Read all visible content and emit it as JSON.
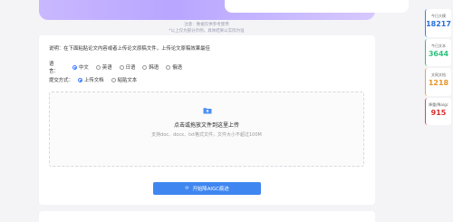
{
  "header": {
    "note_line1": "注意：数据仅供参考使用",
    "note_line2": "*以上仅为部分示例，具体结果以实际为准"
  },
  "form": {
    "instruction": "说明：在下面粘贴论文内容或者上传论文原稿文件，上传论文原稿效果最佳",
    "language_label": "语　　言：",
    "languages": [
      "中文",
      "英语",
      "日语",
      "韩语",
      "俄语"
    ],
    "selected_language": "中文",
    "method_label": "提交方式：",
    "methods": [
      "上传文档",
      "粘贴文本"
    ],
    "selected_method": "上传文档"
  },
  "dropzone": {
    "title": "点击或拖放文件到这里上传",
    "subtitle": "支持doc、docx、txt格式文件，文件大小不超过100M",
    "icon": "folder-upload-icon"
  },
  "start_button": {
    "label": "开始降AIGC痕迹",
    "icon": "refresh-icon"
  },
  "stats": [
    {
      "label": "今日大模",
      "value": "18217",
      "color": "#2a6fd8"
    },
    {
      "label": "今日文本",
      "value": "3644",
      "color": "#2ec27e"
    },
    {
      "label": "文网文档",
      "value": "1218",
      "color": "#e8962a"
    },
    {
      "label": "降重/降aigc",
      "value": "915",
      "color": "#d63030"
    }
  ],
  "colors": {
    "accent": "#3f86f0",
    "banner": "#b8a6ff",
    "background": "#f4f4f7"
  }
}
